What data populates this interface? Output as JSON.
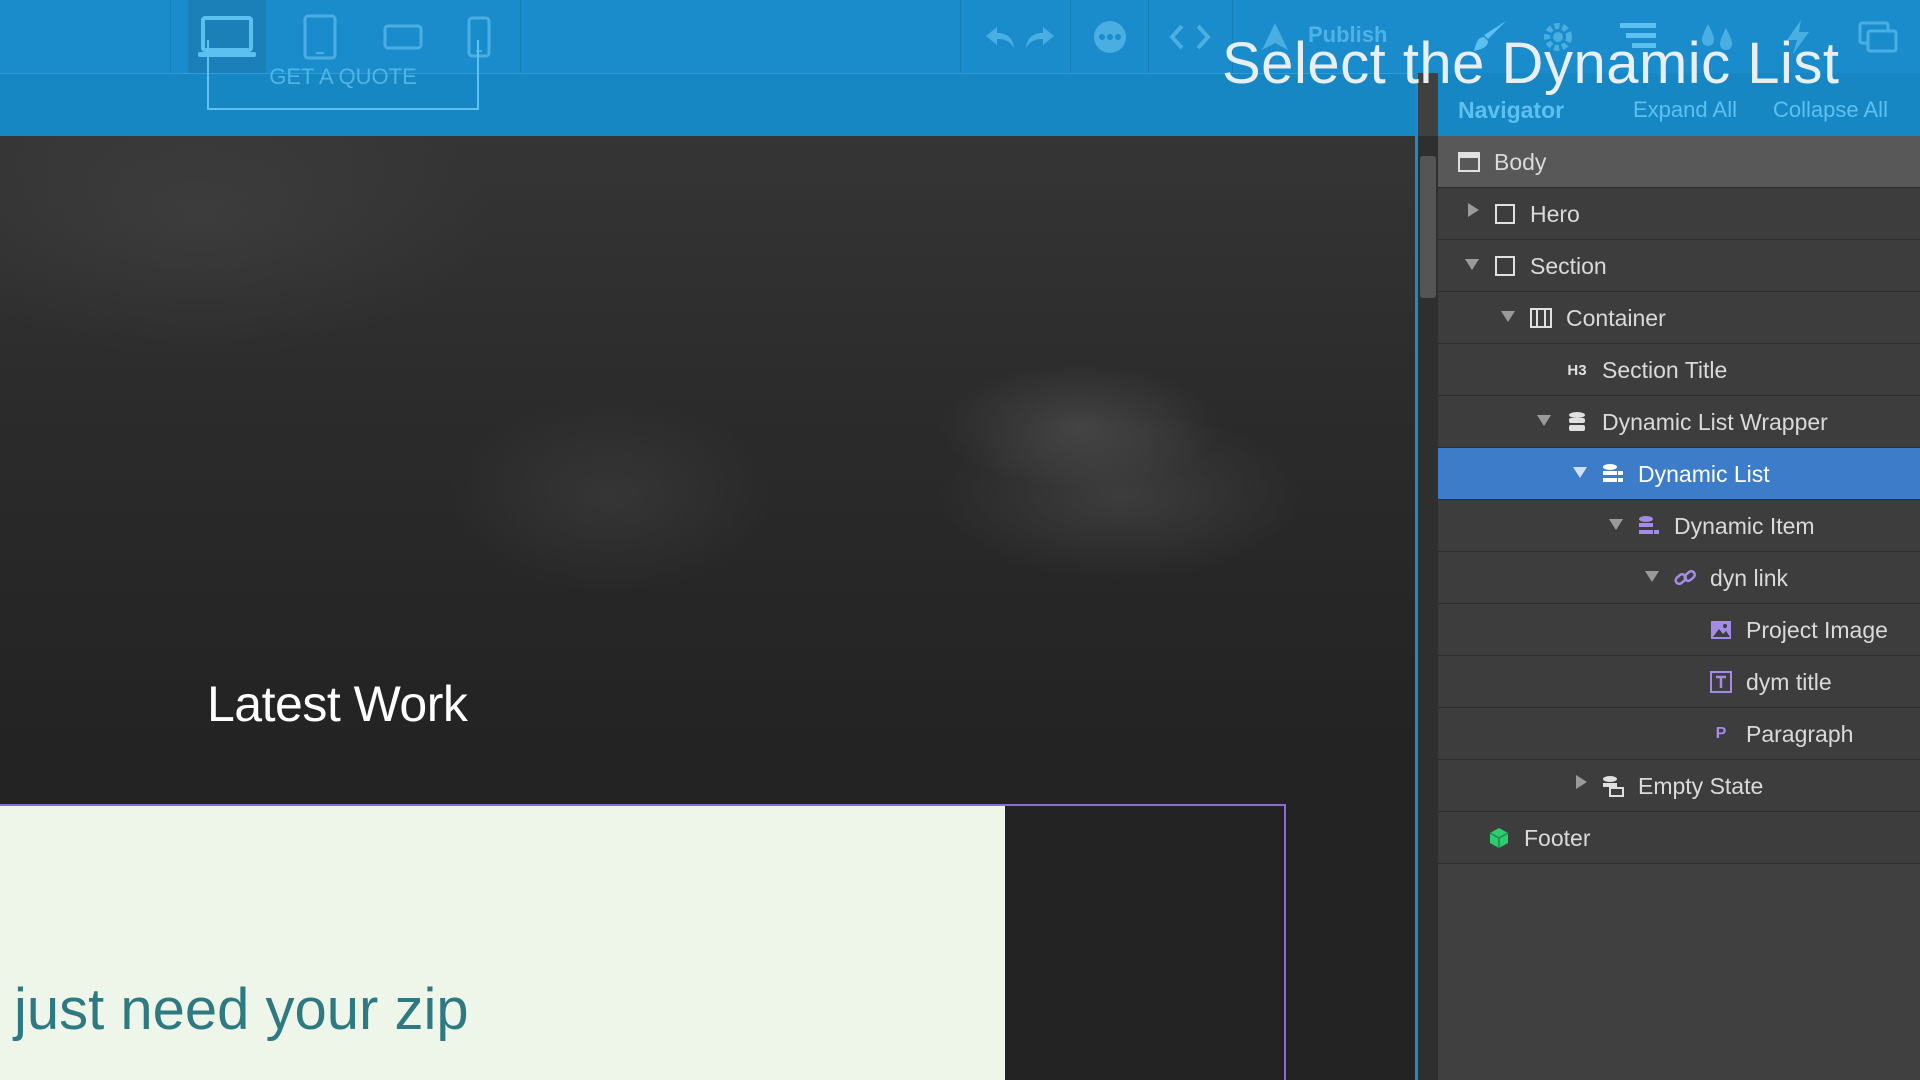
{
  "overlay": {
    "title": "Select the Dynamic List"
  },
  "toolbar": {
    "devices": [
      "desktop-icon",
      "tablet-icon",
      "mobile-landscape-icon",
      "mobile-portrait-icon"
    ],
    "publish_label": "Publish",
    "right_icons": [
      "undo-icon",
      "redo-icon",
      "comments-icon",
      "code-icon",
      "publish-icon",
      "style-brush-icon",
      "settings-gear-icon",
      "navigator-icon",
      "swatches-icon",
      "interactions-icon",
      "assets-icon"
    ]
  },
  "canvas": {
    "hero_button": "GET A QUOTE",
    "section_title": "Latest Work",
    "card_text": "just need your zip"
  },
  "navigator": {
    "title": "Navigator",
    "expand_all": "Expand All",
    "collapse_all": "Collapse All",
    "items": [
      {
        "label": "Body",
        "icon": "body-icon",
        "depth": 0,
        "caret": "none"
      },
      {
        "label": "Hero",
        "icon": "box-icon",
        "depth": 1,
        "caret": "right"
      },
      {
        "label": "Section",
        "icon": "box-icon",
        "depth": 1,
        "caret": "down"
      },
      {
        "label": "Container",
        "icon": "container-icon",
        "depth": 2,
        "caret": "down"
      },
      {
        "label": "Section Title",
        "icon": "heading-h3-icon",
        "depth": 3,
        "caret": "none"
      },
      {
        "label": "Dynamic List Wrapper",
        "icon": "database-icon",
        "depth": 3,
        "caret": "down"
      },
      {
        "label": "Dynamic List",
        "icon": "dynamic-list-icon",
        "depth": 4,
        "caret": "down",
        "selected": true
      },
      {
        "label": "Dynamic Item",
        "icon": "dynamic-item-icon",
        "depth": 5,
        "caret": "down"
      },
      {
        "label": "dyn link",
        "icon": "link-icon",
        "depth": 6,
        "caret": "down"
      },
      {
        "label": "Project Image",
        "icon": "image-icon",
        "depth": 7,
        "caret": "none"
      },
      {
        "label": "dym title",
        "icon": "text-block-icon",
        "depth": 7,
        "caret": "none"
      },
      {
        "label": "Paragraph",
        "icon": "paragraph-icon",
        "depth": 7,
        "caret": "none"
      },
      {
        "label": "Empty State",
        "icon": "empty-state-icon",
        "depth": 4,
        "caret": "right"
      },
      {
        "label": "Footer",
        "icon": "symbol-icon",
        "depth": 1,
        "caret": "none",
        "symbol": true
      }
    ]
  },
  "colors": {
    "toolbar": "#1a8ccb",
    "selected": "#3d7cc9",
    "accent_purple": "#8a6cd8",
    "symbol_green": "#2ecc71"
  }
}
